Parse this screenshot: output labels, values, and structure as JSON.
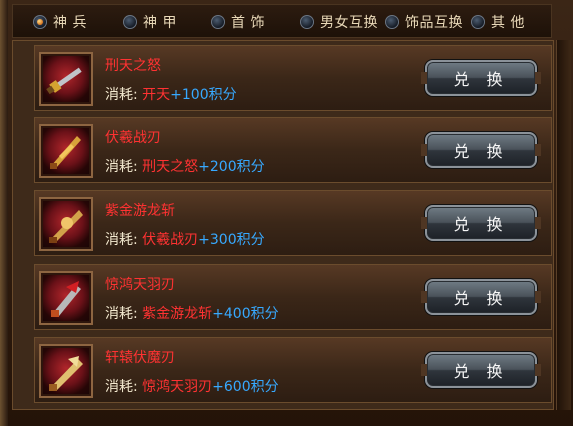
{
  "tabs": [
    {
      "label": "神 兵",
      "active": true
    },
    {
      "label": "神 甲",
      "active": false
    },
    {
      "label": "首 饰",
      "active": false
    },
    {
      "label": "男女互换",
      "active": false
    },
    {
      "label": "饰品互换",
      "active": false
    },
    {
      "label": "其 他",
      "active": false
    }
  ],
  "items": [
    {
      "name": "刑天之怒",
      "cost_label": "消耗:",
      "requires": "开天",
      "points": "+100积分",
      "button": "兑 换",
      "icon": "sword-icon"
    },
    {
      "name": "伏羲战刃",
      "cost_label": "消耗:",
      "requires": "刑天之怒",
      "points": "+200积分",
      "button": "兑 换",
      "icon": "blade-icon"
    },
    {
      "name": "紫金游龙斩",
      "cost_label": "消耗:",
      "requires": "伏羲战刃",
      "points": "+300积分",
      "button": "兑 换",
      "icon": "dragon-blade-icon"
    },
    {
      "name": "惊鸿天羽刃",
      "cost_label": "消耗:",
      "requires": "紫金游龙斩",
      "points": "+400积分",
      "button": "兑 换",
      "icon": "feather-blade-icon"
    },
    {
      "name": "轩辕伏魔刃",
      "cost_label": "消耗:",
      "requires": "惊鸿天羽刃",
      "points": "+600积分",
      "button": "兑 换",
      "icon": "demon-blade-icon"
    }
  ],
  "colors": {
    "item_name": "#ff3232",
    "points": "#37a9ff",
    "label": "#f4ead0"
  }
}
